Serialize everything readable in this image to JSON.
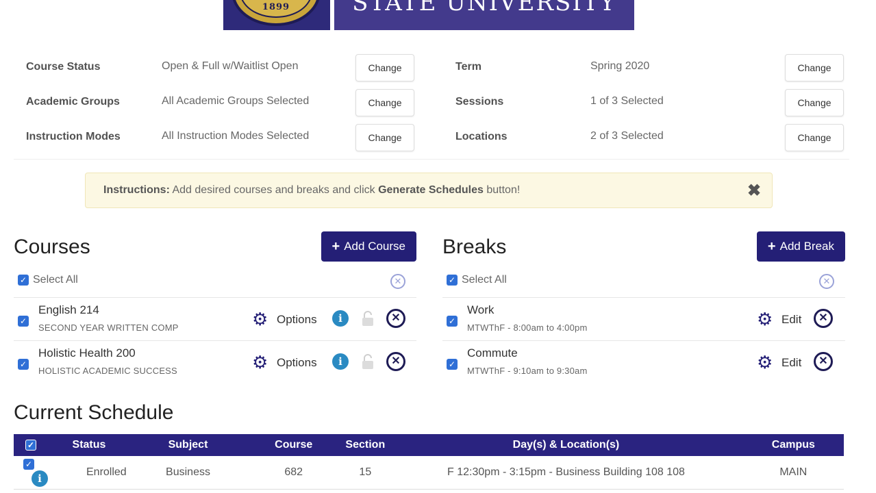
{
  "header": {
    "seal_year": "1899",
    "university_name": "STATE UNIVERSITY"
  },
  "filters": [
    {
      "label": "Course Status",
      "value": "Open & Full w/Waitlist Open",
      "button": "Change"
    },
    {
      "label": "Term",
      "value": "Spring 2020",
      "button": "Change"
    },
    {
      "label": "Academic Groups",
      "value": "All Academic Groups Selected",
      "button": "Change"
    },
    {
      "label": "Sessions",
      "value": "1 of 3 Selected",
      "button": "Change"
    },
    {
      "label": "Instruction Modes",
      "value": "All Instruction Modes Selected",
      "button": "Change"
    },
    {
      "label": "Locations",
      "value": "2 of 3 Selected",
      "button": "Change"
    }
  ],
  "instructions": {
    "prefix": "Instructions:",
    "text_before": " Add desired courses and breaks and click ",
    "bold_text": "Generate Schedules",
    "text_after": " button!",
    "close": "✖"
  },
  "courses": {
    "title": "Courses",
    "add_button": "Add Course",
    "select_all": "Select All",
    "items": [
      {
        "title": "English 214",
        "subtitle": "SECOND YEAR WRITTEN COMP",
        "options": "Options"
      },
      {
        "title": "Holistic Health 200",
        "subtitle": "HOLISTIC ACADEMIC SUCCESS",
        "options": "Options"
      }
    ]
  },
  "breaks": {
    "title": "Breaks",
    "add_button": "Add Break",
    "select_all": "Select All",
    "items": [
      {
        "title": "Work",
        "subtitle": "MTWThF - 8:00am to 4:00pm",
        "options": "Edit"
      },
      {
        "title": "Commute",
        "subtitle": "MTWThF - 9:10am to 9:30am",
        "options": "Edit"
      }
    ]
  },
  "schedule": {
    "title": "Current Schedule",
    "columns": [
      "Status",
      "Subject",
      "Course",
      "Section",
      "Day(s) & Location(s)",
      "Campus"
    ],
    "rows": [
      {
        "status": "Enrolled",
        "subject": "Business",
        "course": "682",
        "section": "15",
        "days_location": "F 12:30pm - 3:15pm - Business Building 108 108",
        "campus": "MAIN"
      }
    ]
  },
  "colors": {
    "brand_navy": "#241f76",
    "table_header": "#2a2380",
    "checkbox_blue": "#2f6fd6",
    "info_blue": "#2a8ac2",
    "instructions_bg": "#fcf8e3"
  }
}
